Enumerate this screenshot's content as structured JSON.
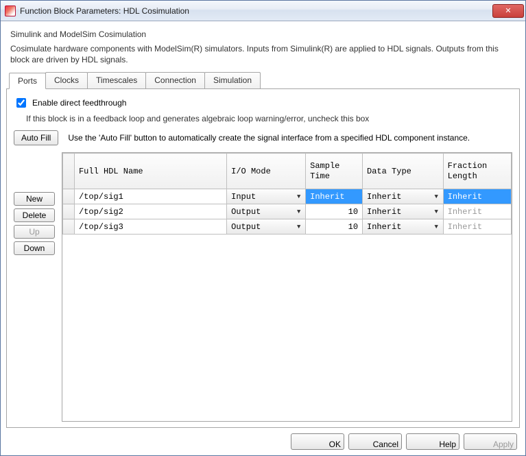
{
  "window": {
    "title": "Function Block Parameters: HDL Cosimulation",
    "close_icon_name": "close-icon"
  },
  "header": {
    "subtitle": "Simulink and ModelSim Cosimulation",
    "description": "Cosimulate hardware components with ModelSim(R) simulators. Inputs from Simulink(R) are applied to HDL signals. Outputs from this block are driven by HDL signals."
  },
  "tabs": {
    "items": [
      {
        "label": "Ports",
        "active": true
      },
      {
        "label": "Clocks",
        "active": false
      },
      {
        "label": "Timescales",
        "active": false
      },
      {
        "label": "Connection",
        "active": false
      },
      {
        "label": "Simulation",
        "active": false
      }
    ]
  },
  "ports_panel": {
    "enable_feedthrough_label": "Enable direct feedthrough",
    "enable_feedthrough_checked": true,
    "feedthrough_hint": "If this block is in a feedback loop and generates algebraic loop warning/error, uncheck this box",
    "auto_fill_label": "Auto Fill",
    "auto_fill_hint": "Use the 'Auto Fill' button to automatically create the signal interface from a specified HDL component instance.",
    "side_buttons": {
      "new": "New",
      "delete": "Delete",
      "up": "Up",
      "down": "Down"
    },
    "columns": {
      "full_hdl_name": "Full HDL Name",
      "io_mode": "I/O Mode",
      "sample_time": "Sample\nTime",
      "data_type": "Data Type",
      "fraction_length": "Fraction\nLength"
    },
    "rows": [
      {
        "name": "/top/sig1",
        "io_mode": "Input",
        "sample_time": "Inherit",
        "sample_time_selected": true,
        "data_type": "Inherit",
        "fraction_length": "Inherit",
        "fl_selected": true,
        "fl_muted": false
      },
      {
        "name": "/top/sig2",
        "io_mode": "Output",
        "sample_time": "10",
        "sample_time_selected": false,
        "data_type": "Inherit",
        "fraction_length": "Inherit",
        "fl_selected": false,
        "fl_muted": true
      },
      {
        "name": "/top/sig3",
        "io_mode": "Output",
        "sample_time": "10",
        "sample_time_selected": false,
        "data_type": "Inherit",
        "fraction_length": "Inherit",
        "fl_selected": false,
        "fl_muted": true
      }
    ]
  },
  "footer": {
    "ok": "OK",
    "cancel": "Cancel",
    "help": "Help",
    "apply": "Apply"
  }
}
